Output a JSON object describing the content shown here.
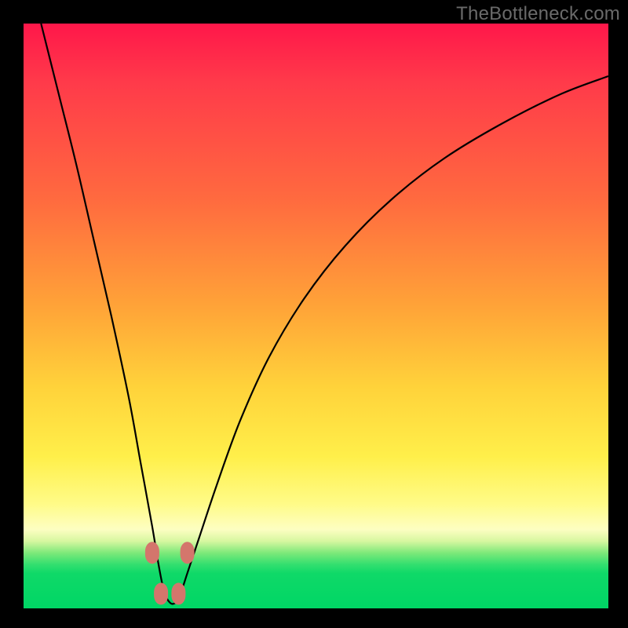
{
  "watermark": "TheBottleneck.com",
  "colors": {
    "frame_bg": "#000000",
    "gradient_top": "#ff174a",
    "gradient_mid": "#ffd23a",
    "gradient_green": "#00d665",
    "curve_stroke": "#000000",
    "marker_fill": "#d4766c"
  },
  "chart_data": {
    "type": "line",
    "title": "",
    "xlabel": "",
    "ylabel": "",
    "xlim": [
      0,
      100
    ],
    "ylim": [
      0,
      100
    ],
    "grid": false,
    "legend": false,
    "note": "Single V-shaped curve starting at top-left, dipping to near-zero around x≈25, rising asymptotically toward the right edge. Axis values are not labeled in the image; x/y are normalized 0–100 estimates read from pixel position.",
    "series": [
      {
        "name": "curve",
        "x": [
          3,
          6,
          9,
          12,
          15,
          18,
          20,
          22,
          23,
          24,
          25,
          26,
          27,
          28,
          30,
          33,
          37,
          42,
          48,
          55,
          63,
          72,
          82,
          92,
          100
        ],
        "y": [
          100,
          88,
          76,
          63,
          50,
          36,
          25,
          14,
          8,
          3,
          1,
          1,
          3,
          6,
          12,
          21,
          32,
          43,
          53,
          62,
          70,
          77,
          83,
          88,
          91
        ]
      }
    ],
    "markers": [
      {
        "x": 22.0,
        "y": 9.5
      },
      {
        "x": 23.5,
        "y": 2.5
      },
      {
        "x": 26.5,
        "y": 2.5
      },
      {
        "x": 28.0,
        "y": 9.5
      }
    ]
  }
}
